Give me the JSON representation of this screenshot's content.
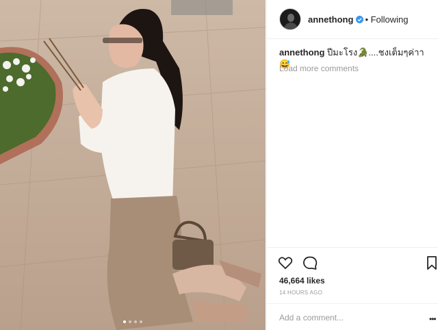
{
  "post": {
    "username": "annethong",
    "follow_status": "• Following",
    "caption_user": "annethong",
    "caption_text": " ปีมะโรง🐊....ชงเต็มๆค่าา😅",
    "load_more": "Load more comments",
    "likes": "46,664 likes",
    "time": "14 HOURS AGO",
    "comment_placeholder": "Add a comment...",
    "more_options": "•••"
  },
  "carousel": {
    "slides": 4,
    "active": 1
  },
  "colors": {
    "verified": "#3897f0",
    "muted": "#999999",
    "text": "#262626",
    "divider": "#efefef"
  },
  "icons": [
    "verified-badge-icon",
    "heart-icon",
    "comment-icon",
    "bookmark-icon",
    "ellipsis-icon"
  ]
}
